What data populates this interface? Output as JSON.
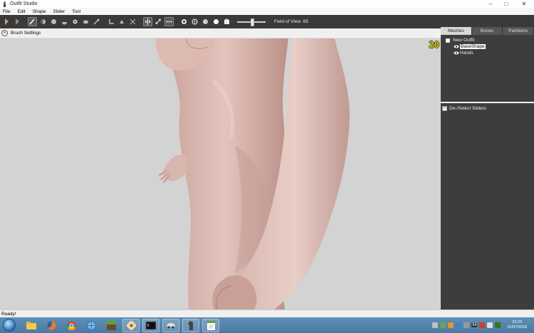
{
  "window": {
    "title": "Outfit Studio",
    "app_icon": "mannequin-icon"
  },
  "menu": {
    "items": [
      "File",
      "Edit",
      "Shape",
      "Slider",
      "Tool"
    ]
  },
  "toolbar": {
    "tool_icons": [
      "select-tool-icon",
      "transform-tool-icon",
      "brush-tool-icon",
      "mask-tool-icon",
      "inflate-tool-icon",
      "deflate-tool-icon",
      "move-tool-icon",
      "smooth-tool-icon",
      "undiff-tool-icon",
      "weight-tool-icon",
      "color-tool-icon",
      "alpha-tool-icon",
      "xmirror-tool-icon",
      "connected-tool-icon",
      "vertex-tool-icon",
      "lighting-tool-icon",
      "wireframe-tool-icon",
      "texture-tool-icon",
      "shading-tool-icon",
      "flip-tool-icon"
    ],
    "fov_label": "Field of View: 65",
    "fov_value": 65,
    "fov_min": 15,
    "fov_max": 120
  },
  "brush_settings": {
    "label": "Brush Settings"
  },
  "viewport": {
    "fps": "20",
    "background": "#d3d3d3"
  },
  "side_panel": {
    "tabs": [
      {
        "label": "Meshes",
        "active": true
      },
      {
        "label": "Bones",
        "active": false
      },
      {
        "label": "Partitions",
        "active": false
      }
    ],
    "tree": {
      "root": "New Outfit",
      "items": [
        "BaseShape",
        "Hands"
      ],
      "selected": "BaseShape"
    },
    "sliders_header": "De-/Select Sliders"
  },
  "status": {
    "text": "Ready!"
  },
  "taskbar": {
    "apps": [
      "explorer-icon",
      "firefox-icon",
      "chrome-icon",
      "globe-icon",
      "minecraft-icon",
      "sawblade-icon",
      "terminal-icon",
      "car-icon",
      "horse-icon",
      "notepad-icon"
    ],
    "clock_time": "22:23",
    "clock_date": "31/07/2018",
    "tray_badge": "54"
  },
  "colors": {
    "accent": "#4a7aa3",
    "toolbar": "#3a3a3a",
    "panel": "#3d3d3d",
    "fps_color": "#e6d800"
  }
}
